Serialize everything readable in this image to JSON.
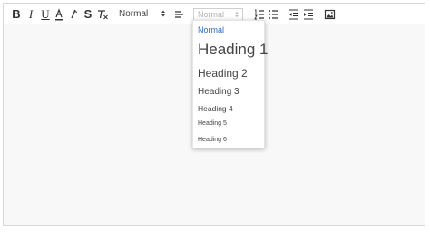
{
  "toolbar": {
    "bold_label": "B",
    "italic_label": "I",
    "underline_label": "U",
    "strike_label": "S",
    "header_select": {
      "value": "Normal"
    },
    "size_select": {
      "value": "Normal"
    }
  },
  "dropdown": {
    "items": [
      {
        "label": "Normal",
        "selected": true
      },
      {
        "label": "Heading 1"
      },
      {
        "label": "Heading 2"
      },
      {
        "label": "Heading 3"
      },
      {
        "label": "Heading 4"
      },
      {
        "label": "Heading 5"
      },
      {
        "label": "Heading 6"
      }
    ]
  },
  "colors": {
    "selected_item": "#2a6bc4",
    "text": "#444444",
    "border": "#d7d7d7",
    "editor_bg": "#f8f8f8"
  }
}
